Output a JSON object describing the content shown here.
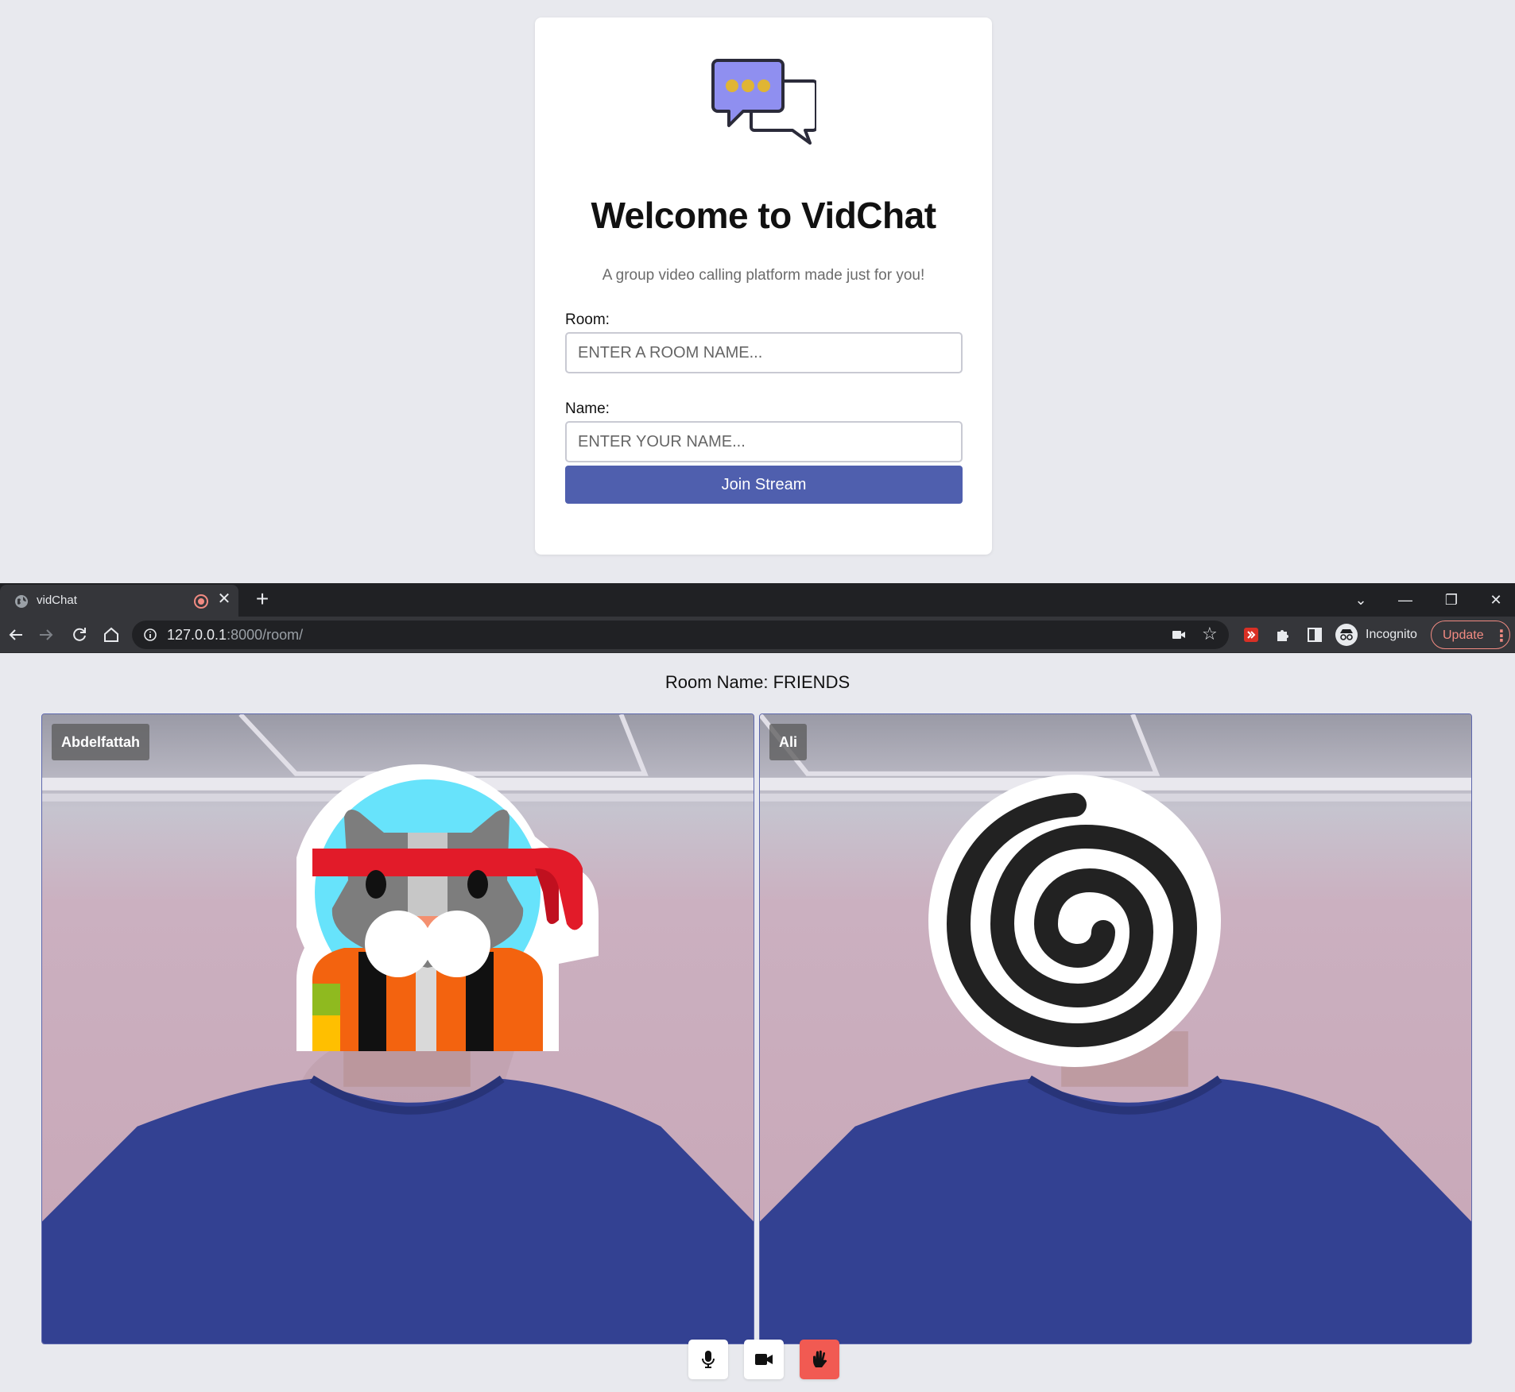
{
  "lobby": {
    "title": "Welcome to VidChat",
    "subtitle": "A group video calling platform made just for you!",
    "room_label": "Room:",
    "room_placeholder": "ENTER A ROOM NAME...",
    "name_label": "Name:",
    "name_placeholder": "ENTER YOUR NAME...",
    "join_button": "Join Stream",
    "logo_icon": "chat-bubbles-icon",
    "colors": {
      "button": "#4f5fae",
      "logo_bubble": "#8f8ff0",
      "logo_dots": "#e0b534"
    }
  },
  "browser": {
    "tab_title": "vidChat",
    "url_host": "127.0.0.1",
    "url_rest": ":8000/room/",
    "incognito_label": "Incognito",
    "update_label": "Update"
  },
  "room": {
    "heading": "Room Name: FRIENDS",
    "participants": [
      {
        "name": "Abdelfattah",
        "avatar": "ninja-cat-avatar"
      },
      {
        "name": "Ali",
        "avatar": "spiral-avatar"
      }
    ],
    "controls": [
      {
        "icon": "microphone-icon"
      },
      {
        "icon": "camera-icon"
      },
      {
        "icon": "leave-hand-icon",
        "color": "#f15a52"
      }
    ]
  }
}
